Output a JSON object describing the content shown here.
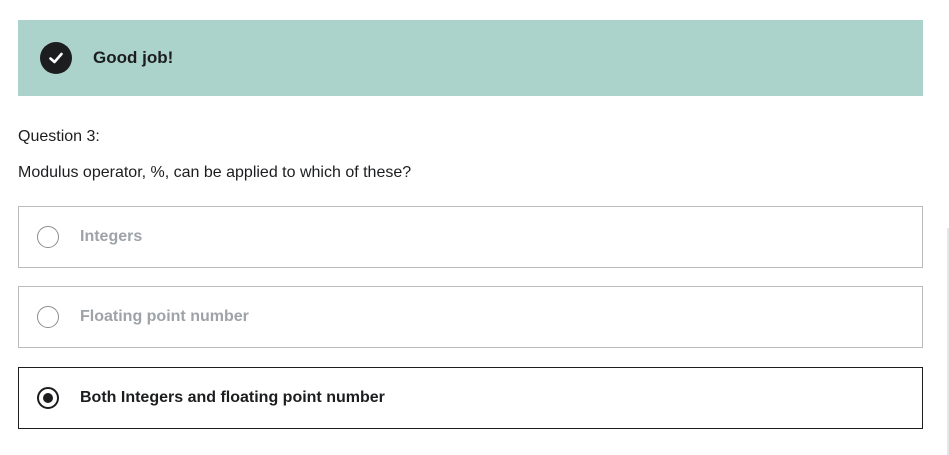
{
  "feedback": {
    "message": "Good job!",
    "icon": "checkmark-circle-icon",
    "background_color": "#acd2cc"
  },
  "question": {
    "number_label": "Question 3:",
    "text": "Modulus operator, %, can be applied to which of these?"
  },
  "options": [
    {
      "label": "Integers",
      "selected": false
    },
    {
      "label": "Floating point number",
      "selected": false
    },
    {
      "label": "Both Integers and floating point number",
      "selected": true
    }
  ]
}
